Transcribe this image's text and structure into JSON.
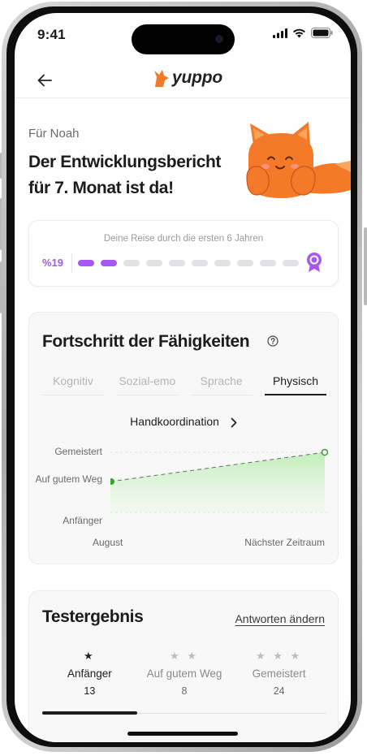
{
  "status_bar": {
    "time": "9:41"
  },
  "nav": {
    "brand": "yuppo"
  },
  "header": {
    "for_who": "Für Noah",
    "headline_line1": "Der Entwicklungsbericht",
    "headline_line2": "für  7. Monat ist da!"
  },
  "journey": {
    "title": "Deine Reise durch die ersten 6 Jahren",
    "percent": "%19",
    "filled_segments": 2,
    "total_segments": 10
  },
  "skills": {
    "title": "Fortschritt der Fähigkeiten",
    "tabs": [
      {
        "label": "Kognitiv",
        "active": false
      },
      {
        "label": "Sozial-emo",
        "active": false
      },
      {
        "label": "Sprache",
        "active": false
      },
      {
        "label": "Physisch",
        "active": true
      }
    ],
    "subcategory": "Handkoordination"
  },
  "chart_data": {
    "type": "line",
    "y_levels": [
      "Anfänger",
      "Auf gutem Weg",
      "Gemeistert"
    ],
    "x": [
      "August",
      "Nächster Zeitraum"
    ],
    "series": [
      {
        "values": [
          "Auf gutem Weg",
          "Gemeistert"
        ]
      }
    ],
    "grid": true
  },
  "test": {
    "title": "Testergebnis",
    "link": "Antworten ändern",
    "levels": [
      {
        "stars": "★",
        "name": "Anfänger",
        "count": "13",
        "active": true
      },
      {
        "stars": "★ ★",
        "name": "Auf gutem Weg",
        "count": "8",
        "active": false
      },
      {
        "stars": "★ ★ ★",
        "name": "Gemeistert",
        "count": "24",
        "active": false
      }
    ]
  },
  "colors": {
    "accent_purple": "#a659f0",
    "chart_green": "#3aa132",
    "brand_orange": "#f47a2a"
  }
}
